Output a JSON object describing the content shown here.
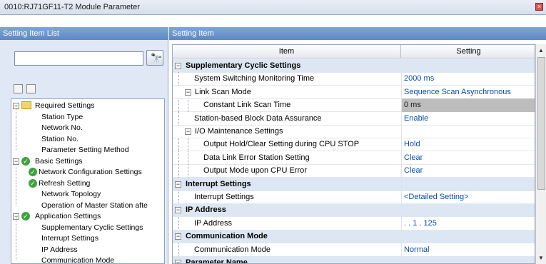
{
  "window": {
    "title": "0010:RJ71GF11-T2 Module Parameter",
    "close_glyph": "×"
  },
  "left": {
    "header": "Setting Item List",
    "search": {
      "value": "",
      "placeholder": ""
    },
    "search_icon": "binoculars-icon",
    "tree": [
      {
        "label": "Required Settings",
        "level": 0,
        "kind": "folder"
      },
      {
        "label": "Station Type",
        "level": 1
      },
      {
        "label": "Network No.",
        "level": 1
      },
      {
        "label": "Station No.",
        "level": 1
      },
      {
        "label": "Parameter Setting Method",
        "level": 1
      },
      {
        "label": "Basic Settings",
        "level": 0,
        "kind": "check"
      },
      {
        "label": "Network Configuration Settings",
        "level": 1,
        "kind": "check"
      },
      {
        "label": "Refresh Setting",
        "level": 1,
        "kind": "check"
      },
      {
        "label": "Network Topology",
        "level": 1
      },
      {
        "label": "Operation of Master Station afte",
        "level": 1
      },
      {
        "label": "Application Settings",
        "level": 0,
        "kind": "check"
      },
      {
        "label": "Supplementary Cyclic Settings",
        "level": 1
      },
      {
        "label": "Interrupt Settings",
        "level": 1
      },
      {
        "label": "IP Address",
        "level": 1
      },
      {
        "label": "Communication Mode",
        "level": 1
      }
    ]
  },
  "right": {
    "header": "Setting Item",
    "columns": {
      "item": "Item",
      "setting": "Setting"
    },
    "rows": [
      {
        "type": "group",
        "item": "Supplementary Cyclic Settings",
        "value": ""
      },
      {
        "item": "System Switching Monitoring Time",
        "value": "2000 ms",
        "indent": 1
      },
      {
        "type": "subgroup",
        "item": "Link Scan Mode",
        "value": "Sequence Scan Asynchronous",
        "indent": 1
      },
      {
        "item": "Constant Link Scan Time",
        "value": "0 ms",
        "indent": 2,
        "selected": true
      },
      {
        "item": "Station-based Block Data Assurance",
        "value": "Enable",
        "indent": 1
      },
      {
        "type": "subgroup",
        "item": "I/O Maintenance Settings",
        "value": "",
        "indent": 1
      },
      {
        "item": "Output Hold/Clear Setting during CPU STOP",
        "value": "Hold",
        "indent": 2
      },
      {
        "item": "Data Link Error Station Setting",
        "value": "Clear",
        "indent": 2
      },
      {
        "item": "Output Mode upon CPU Error",
        "value": "Clear",
        "indent": 2
      },
      {
        "type": "group",
        "item": "Interrupt Settings",
        "value": ""
      },
      {
        "item": "Interrupt Settings",
        "value": "<Detailed Setting>",
        "indent": 1
      },
      {
        "type": "group",
        "item": "IP Address",
        "value": ""
      },
      {
        "item": "IP Address",
        "value": ".    .  1 . 125",
        "indent": 1
      },
      {
        "type": "group",
        "item": "Communication Mode",
        "value": ""
      },
      {
        "item": "Communication Mode",
        "value": "Normal",
        "indent": 1
      },
      {
        "type": "group",
        "item": "Parameter Name",
        "value": ""
      }
    ]
  }
}
